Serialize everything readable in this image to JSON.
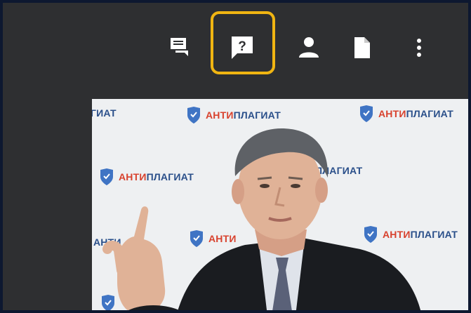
{
  "toolbar": {
    "buttons": [
      {
        "name": "chat-icon",
        "highlighted": false
      },
      {
        "name": "question-icon",
        "highlighted": true,
        "glyph": "?"
      },
      {
        "name": "person-icon",
        "highlighted": false
      },
      {
        "name": "document-icon",
        "highlighted": false
      },
      {
        "name": "more-vertical-icon",
        "highlighted": false
      }
    ],
    "highlight_color": "#f0b512"
  },
  "video": {
    "watermark": {
      "part_red": "АНТИ",
      "part_blue": "ПЛАГИАТ",
      "partial_left": "ГИАТ",
      "partial_left2": "АНТИ"
    },
    "colors": {
      "backdrop": "#eef0f2",
      "brand_blue": "#2a4f8a",
      "brand_red": "#d8422e",
      "suit": "#1a1c20"
    }
  }
}
